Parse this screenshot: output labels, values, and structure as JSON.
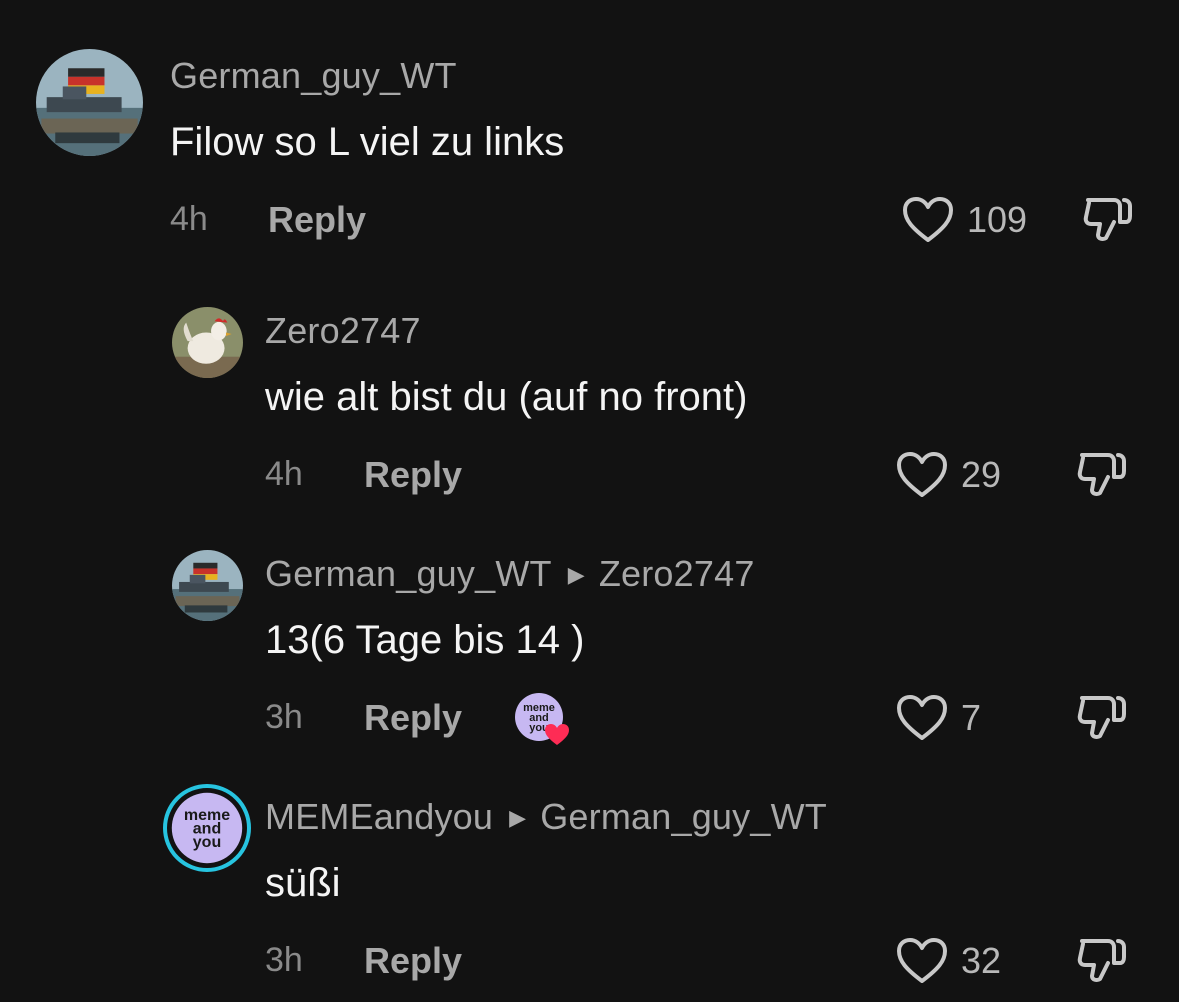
{
  "comments": [
    {
      "username": "German_guy_WT",
      "reply_to": "",
      "text": "Filow so L viel zu links",
      "time": "4h",
      "reply_label": "Reply",
      "likes": "109",
      "avatar_icon": "warship-flag-avatar"
    },
    {
      "username": "Zero2747",
      "reply_to": "",
      "text": "wie alt bist du (auf no front)",
      "time": "4h",
      "reply_label": "Reply",
      "likes": "29",
      "avatar_icon": "rooster-avatar"
    },
    {
      "username": "German_guy_WT",
      "reply_to": "Zero2747",
      "text": "13(6 Tage bis 14 )",
      "time": "3h",
      "reply_label": "Reply",
      "likes": "7",
      "avatar_icon": "warship-flag-avatar",
      "creator_liked_avatar_text": "meme and you"
    },
    {
      "username": "MEMEandyou",
      "reply_to": "German_guy_WT",
      "text": "süßi",
      "time": "3h",
      "reply_label": "Reply",
      "likes": "32",
      "avatar_icon": "meme-and-you-avatar",
      "avatar_text": "meme and you"
    }
  ],
  "colors": {
    "background": "#121212",
    "username": "#a8a8a8",
    "text": "#f4f4f4",
    "heart_badge": "#fe2c55",
    "meme_avatar_bg": "#c7b8f2",
    "story_ring": "#27c4e0"
  }
}
